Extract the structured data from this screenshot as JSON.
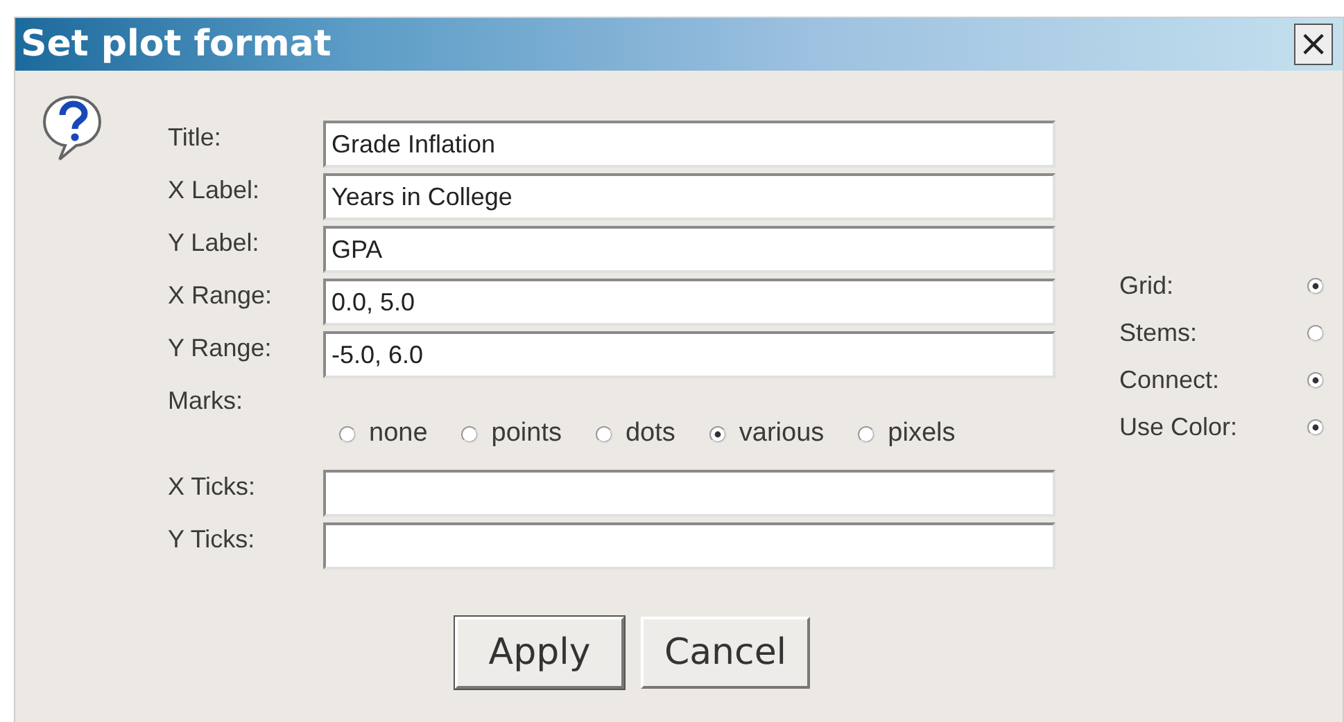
{
  "window": {
    "title": "Set plot format",
    "close": "×"
  },
  "fields": [
    {
      "label": "Title:",
      "value": "Grade Inflation"
    },
    {
      "label": "X Label:",
      "value": "Years in College"
    },
    {
      "label": "Y Label:",
      "value": "GPA"
    },
    {
      "label": "X Range:",
      "value": "0.0, 5.0"
    },
    {
      "label": "Y Range:",
      "value": "-5.0, 6.0"
    }
  ],
  "marks": {
    "label": "Marks:",
    "options": [
      {
        "label": "none",
        "selected": false
      },
      {
        "label": "points",
        "selected": false
      },
      {
        "label": "dots",
        "selected": false
      },
      {
        "label": "various",
        "selected": true
      },
      {
        "label": "pixels",
        "selected": false
      }
    ]
  },
  "tick_fields": [
    {
      "label": "X Ticks:"
    },
    {
      "label": "Y Ticks:"
    }
  ],
  "options": [
    {
      "label": "Grid:",
      "checked": true
    },
    {
      "label": "Stems:",
      "checked": false
    },
    {
      "label": "Connect:",
      "checked": true
    },
    {
      "label": "Use Color:",
      "checked": true
    }
  ],
  "buttons": [
    "Apply",
    "Cancel"
  ]
}
